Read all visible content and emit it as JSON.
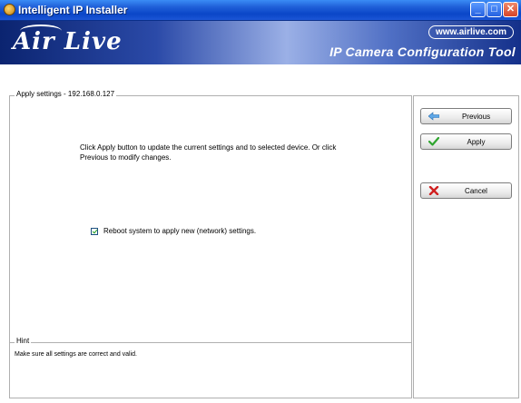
{
  "window": {
    "title": "Intelligent IP Installer"
  },
  "banner": {
    "brand": "Air Live",
    "url": "www.airlive.com",
    "tool_title": "IP Camera Configuration Tool"
  },
  "main": {
    "group_caption": "Apply settings - 192.168.0.127",
    "instruction": "Click Apply button to update the current settings and to selected device. Or click Previous to modify changes.",
    "reboot_label": "Reboot system to apply  new (network) settings.",
    "reboot_checked": true
  },
  "hint": {
    "caption": "Hint",
    "text": "Make sure all settings are correct and valid."
  },
  "buttons": {
    "previous": "Previous",
    "apply": "Apply",
    "cancel": "Cancel"
  },
  "icons": {
    "previous": "arrow-left-icon",
    "apply": "checkmark-icon",
    "cancel": "x-icon"
  },
  "colors": {
    "titlebar": "#1f5fd8",
    "banner": "#2b4aa8"
  }
}
